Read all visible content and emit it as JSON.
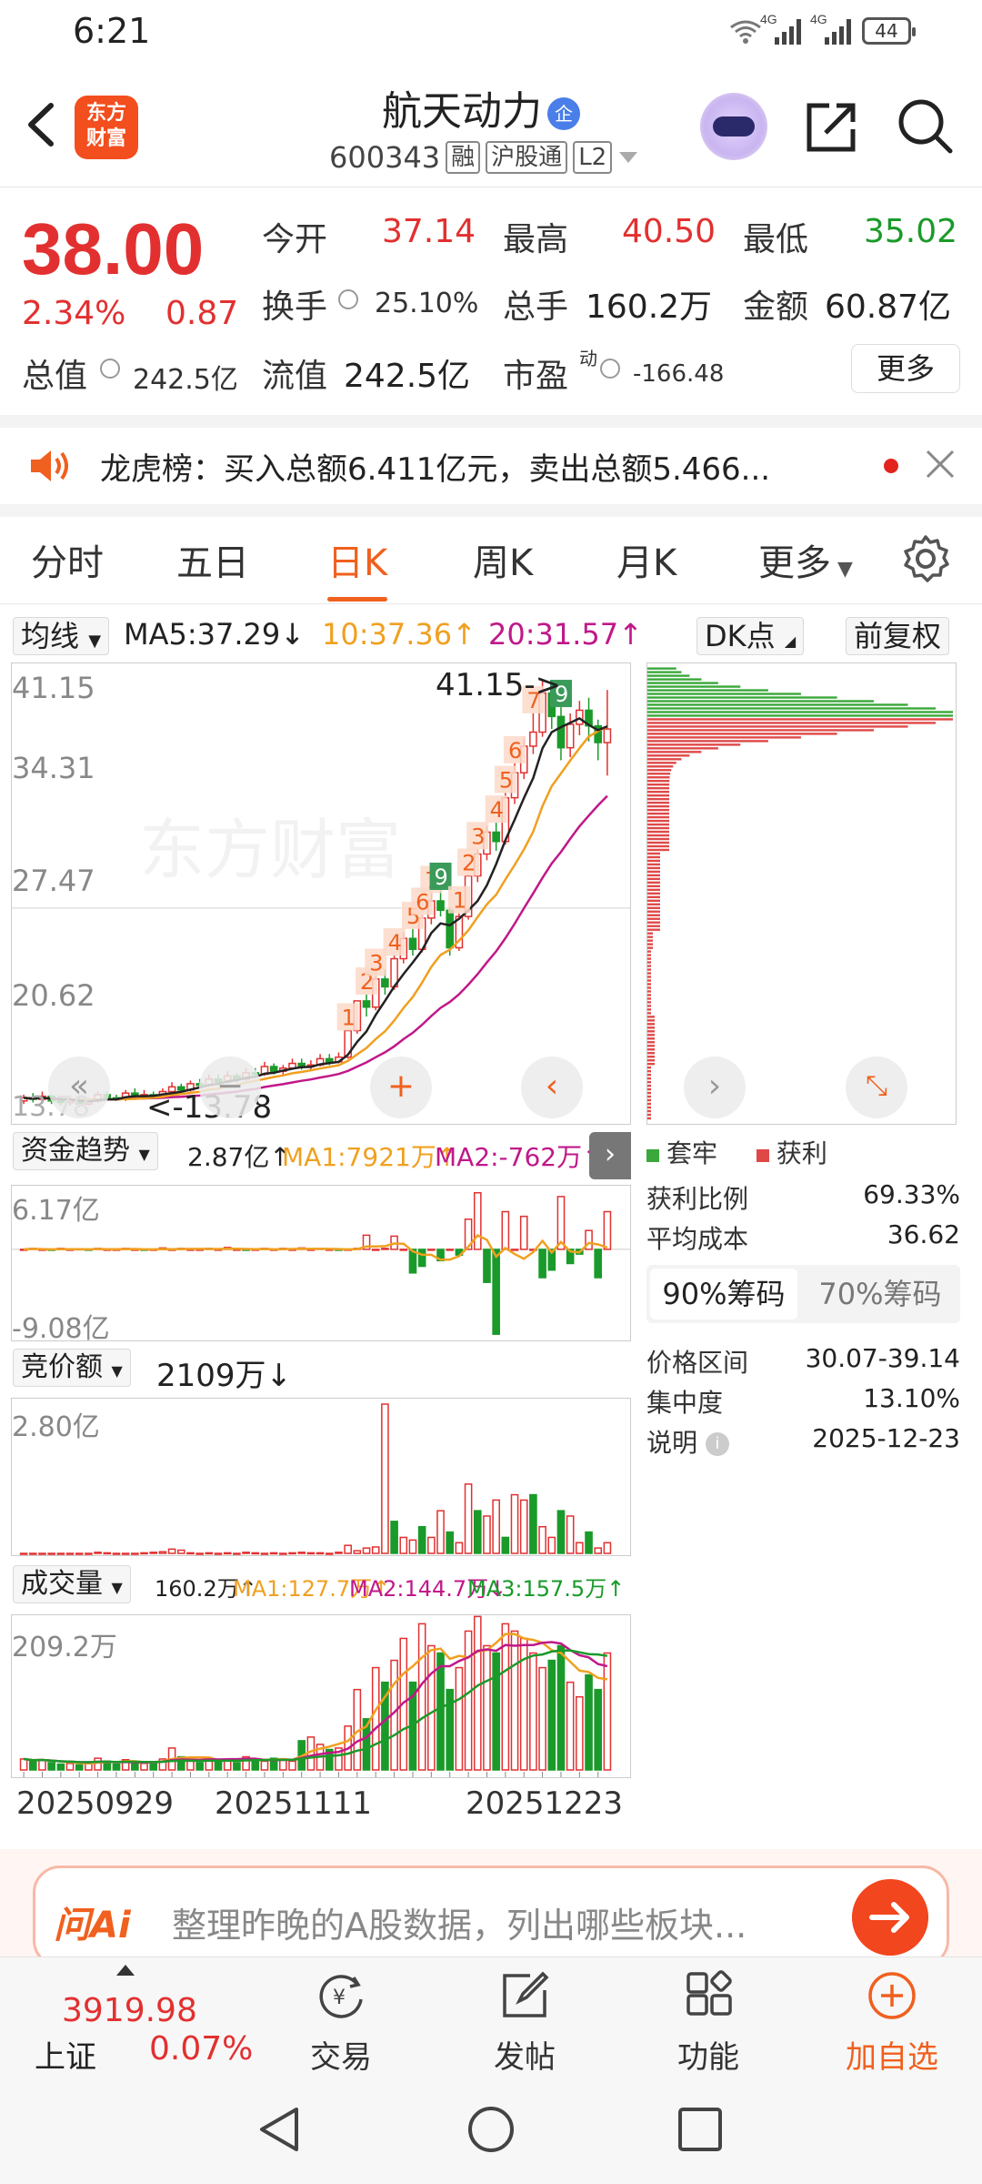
{
  "status": {
    "time": "6:21",
    "net1": "4G",
    "net2": "4G",
    "battery": "44"
  },
  "header": {
    "brand": "东方财富",
    "title": "航天动力",
    "title_badge": "企",
    "code": "600343",
    "tags": [
      "融",
      "沪股通",
      "L2"
    ]
  },
  "quote": {
    "price": "38.00",
    "change_pct": "2.34%",
    "change": "0.87",
    "open_label": "今开",
    "open": "37.14",
    "high_label": "最高",
    "high": "40.50",
    "low_label": "最低",
    "low": "35.02",
    "turnover_label": "换手",
    "turnover": "25.10%",
    "volume_label": "总手",
    "volume": "160.2万",
    "amount_label": "金额",
    "amount": "60.87亿",
    "mktcap_label": "总值",
    "mktcap": "242.5亿",
    "float_label": "流值",
    "float_cap": "242.5亿",
    "pe_label": "市盈",
    "pe_sup": "动",
    "pe": "-166.48",
    "more": "更多"
  },
  "notice": {
    "text": "龙虎榜：买入总额6.411亿元，卖出总额5.466..."
  },
  "tabs": [
    "分时",
    "五日",
    "日K",
    "周K",
    "月K",
    "更多"
  ],
  "active_tab": "日K",
  "indicators": {
    "ma_dd": "均线",
    "ma5": "MA5:37.29↓",
    "ma10": "10:37.36↑",
    "ma20": "20:31.57↑",
    "dk": "DK点",
    "fq": "前复权"
  },
  "colors": {
    "red": "#e23030",
    "green": "#1a9a2a",
    "orange": "#f0601e",
    "ma5": "#222222",
    "ma10": "#f0a020",
    "ma20": "#c0188a"
  },
  "chart_data": {
    "type": "candlestick",
    "price_axis": [
      "41.15",
      "34.31",
      "27.47",
      "20.62",
      "13.78"
    ],
    "ylim": [
      13.78,
      41.15
    ],
    "high_label": "41.15",
    "low_label": "13.78",
    "date_labels": [
      "20250929",
      "20251111",
      "20251223"
    ],
    "candles": [
      [
        14.2,
        14.4,
        14.6,
        14.0
      ],
      [
        14.4,
        14.3,
        14.7,
        14.1
      ],
      [
        14.3,
        14.5,
        14.8,
        14.2
      ],
      [
        14.5,
        14.2,
        14.6,
        14.0
      ],
      [
        14.2,
        14.1,
        14.4,
        13.9
      ],
      [
        14.1,
        14.3,
        14.5,
        13.9
      ],
      [
        14.3,
        14.0,
        14.4,
        13.8
      ],
      [
        14.0,
        14.2,
        14.4,
        13.9
      ],
      [
        14.2,
        14.6,
        14.8,
        14.1
      ],
      [
        14.6,
        14.4,
        14.8,
        14.3
      ],
      [
        14.4,
        14.3,
        14.6,
        14.2
      ],
      [
        14.3,
        14.7,
        14.9,
        14.2
      ],
      [
        14.7,
        14.5,
        15.0,
        14.4
      ],
      [
        14.5,
        14.6,
        14.9,
        14.3
      ],
      [
        14.6,
        14.5,
        14.8,
        14.3
      ],
      [
        14.5,
        14.8,
        15.0,
        14.4
      ],
      [
        14.8,
        15.1,
        15.4,
        14.7
      ],
      [
        15.1,
        14.9,
        15.3,
        14.7
      ],
      [
        14.9,
        15.3,
        15.5,
        14.8
      ],
      [
        15.3,
        15.2,
        15.6,
        15.0
      ],
      [
        15.2,
        15.6,
        15.9,
        15.1
      ],
      [
        15.6,
        15.4,
        15.9,
        15.3
      ],
      [
        15.4,
        15.8,
        16.1,
        15.3
      ],
      [
        15.8,
        15.6,
        16.0,
        15.4
      ],
      [
        15.6,
        16.0,
        16.3,
        15.5
      ],
      [
        16.0,
        15.9,
        16.3,
        15.7
      ],
      [
        15.9,
        16.4,
        16.7,
        15.8
      ],
      [
        16.4,
        16.1,
        16.6,
        15.9
      ],
      [
        16.1,
        16.3,
        16.5,
        15.9
      ],
      [
        16.3,
        16.6,
        16.9,
        16.2
      ],
      [
        16.6,
        16.4,
        16.9,
        16.2
      ],
      [
        16.4,
        16.5,
        16.8,
        16.2
      ],
      [
        16.5,
        16.9,
        17.2,
        16.4
      ],
      [
        16.9,
        16.7,
        17.2,
        16.5
      ],
      [
        16.7,
        17.0,
        17.3,
        16.6
      ],
      [
        17.0,
        18.7,
        18.7,
        16.9
      ],
      [
        18.7,
        20.6,
        20.6,
        18.5
      ],
      [
        20.6,
        20.2,
        21.0,
        19.6
      ],
      [
        20.2,
        22.0,
        22.2,
        20.0
      ],
      [
        22.0,
        21.5,
        22.6,
        21.0
      ],
      [
        21.5,
        23.3,
        23.5,
        21.3
      ],
      [
        23.3,
        24.6,
        25.0,
        23.0
      ],
      [
        24.6,
        23.9,
        25.2,
        23.5
      ],
      [
        23.9,
        25.9,
        26.1,
        23.7
      ],
      [
        25.9,
        27.0,
        27.5,
        25.5
      ],
      [
        27.0,
        26.4,
        27.7,
        26.0
      ],
      [
        26.4,
        24.0,
        26.6,
        23.5
      ],
      [
        24.0,
        26.0,
        26.2,
        23.8
      ],
      [
        26.0,
        28.6,
        28.6,
        25.8
      ],
      [
        28.6,
        30.0,
        30.3,
        28.2
      ],
      [
        30.0,
        31.4,
        31.8,
        29.6
      ],
      [
        31.4,
        30.8,
        32.0,
        30.2
      ],
      [
        30.8,
        33.6,
        33.9,
        30.6
      ],
      [
        33.6,
        35.2,
        35.8,
        33.2
      ],
      [
        35.2,
        36.9,
        37.4,
        34.8
      ],
      [
        36.9,
        37.8,
        39.0,
        36.4
      ],
      [
        37.8,
        40.3,
        41.15,
        37.5
      ],
      [
        40.3,
        38.8,
        40.8,
        38.0
      ],
      [
        38.8,
        36.8,
        39.4,
        36.0
      ],
      [
        36.8,
        38.3,
        39.0,
        36.2
      ],
      [
        38.3,
        39.2,
        39.8,
        37.6
      ],
      [
        39.2,
        38.2,
        40.0,
        37.2
      ],
      [
        38.2,
        37.13,
        38.6,
        36.0
      ],
      [
        37.13,
        38.0,
        40.5,
        35.02
      ]
    ],
    "signal_labels": [
      {
        "i": 35,
        "t": "1"
      },
      {
        "i": 37,
        "t": "2"
      },
      {
        "i": 38,
        "t": "3"
      },
      {
        "i": 40,
        "t": "4"
      },
      {
        "i": 42,
        "t": "5"
      },
      {
        "i": 43,
        "t": "6"
      },
      {
        "i": 44,
        "t": "7"
      },
      {
        "i": 45,
        "t": "9",
        "g": true
      },
      {
        "i": 47,
        "t": "1"
      },
      {
        "i": 48,
        "t": "2"
      },
      {
        "i": 49,
        "t": "3"
      },
      {
        "i": 51,
        "t": "4"
      },
      {
        "i": 52,
        "t": "5"
      },
      {
        "i": 53,
        "t": "6"
      },
      {
        "i": 55,
        "t": "7"
      },
      {
        "i": 58,
        "t": "9",
        "g": true
      }
    ]
  },
  "chip": {
    "legend_trap": "套牢",
    "legend_profit": "获利",
    "profit_ratio_label": "获利比例",
    "profit_ratio": "69.33%",
    "avg_cost_label": "平均成本",
    "avg_cost": "36.62",
    "tab_90": "90%筹码",
    "tab_70": "70%筹码",
    "range_label": "价格区间",
    "range": "30.07-39.14",
    "conc_label": "集中度",
    "conc": "13.10%",
    "note_label": "说明",
    "note_date": "2025-12-23"
  },
  "fund": {
    "dd": "资金趋势",
    "val": "2.87亿↑",
    "ma1": "MA1:7921万↑",
    "ma2": "MA2:-762万↑",
    "top": "6.17亿",
    "bottom": "-9.08亿",
    "values": [
      0,
      0.1,
      0,
      -0.1,
      0.1,
      0,
      0.05,
      -0.05,
      0.1,
      0,
      0,
      0.1,
      0,
      -0.1,
      0,
      0.15,
      0,
      0.1,
      0,
      0,
      0.1,
      0,
      0.2,
      0,
      -0.1,
      0,
      0.1,
      0,
      0.1,
      0,
      0.15,
      0,
      0.1,
      0,
      -0.1,
      0,
      0.1,
      1.5,
      0,
      0.1,
      1.4,
      0,
      -2.5,
      -1.8,
      0,
      -1.2,
      0,
      -0.6,
      3.2,
      6.0,
      -3.5,
      -9.0,
      4.0,
      0,
      3.5,
      0,
      -3.0,
      -2.2,
      5.6,
      -1.5,
      -0.5,
      2.0,
      -3.0,
      4.0
    ]
  },
  "auction": {
    "dd": "竞价额",
    "val": "2109万↓",
    "top": "2.80亿",
    "values": [
      0,
      0,
      0,
      0,
      0,
      0,
      0,
      0,
      0.02,
      0.01,
      0,
      0,
      0,
      0.01,
      0.02,
      0.03,
      0.08,
      0.06,
      0.01,
      0,
      0.01,
      0,
      0.01,
      0,
      0.02,
      0.01,
      0,
      0.01,
      0,
      0.01,
      0.02,
      0.01,
      0.01,
      0,
      0.02,
      0.15,
      0.05,
      0.1,
      0.12,
      2.8,
      0.6,
      0.3,
      0.25,
      0.5,
      0.3,
      0.8,
      0.4,
      0.2,
      1.3,
      0.8,
      0.7,
      1.0,
      0.3,
      1.1,
      1.0,
      1.1,
      0.5,
      0.3,
      0.8,
      0.7,
      0.2,
      0.4,
      0.1,
      0.2
    ]
  },
  "volume": {
    "dd": "成交量",
    "val": "160.2万↑",
    "ma1": "MA1:127.7万↑",
    "ma2": "MA2:144.7万↓",
    "ma3": "MA3:157.5万↑",
    "top": "209.2万",
    "values": [
      15,
      12,
      14,
      10,
      8,
      9,
      7,
      10,
      16,
      12,
      8,
      14,
      10,
      9,
      11,
      15,
      30,
      18,
      12,
      10,
      16,
      12,
      14,
      10,
      18,
      15,
      12,
      16,
      14,
      12,
      40,
      45,
      35,
      28,
      30,
      60,
      110,
      70,
      140,
      120,
      150,
      180,
      120,
      200,
      170,
      160,
      110,
      140,
      190,
      210,
      170,
      160,
      200,
      190,
      180,
      160,
      140,
      150,
      170,
      120,
      100,
      130,
      110,
      160
    ]
  },
  "ai": {
    "logo": "问Ai",
    "text": "整理昨晚的A股数据，列出哪些板块..."
  },
  "bottom": {
    "index_value": "3919.98",
    "index_name": "上证",
    "index_pct": "0.07%",
    "items": [
      {
        "label": "交易"
      },
      {
        "label": "发帖"
      },
      {
        "label": "功能"
      },
      {
        "label": "加自选"
      }
    ]
  }
}
